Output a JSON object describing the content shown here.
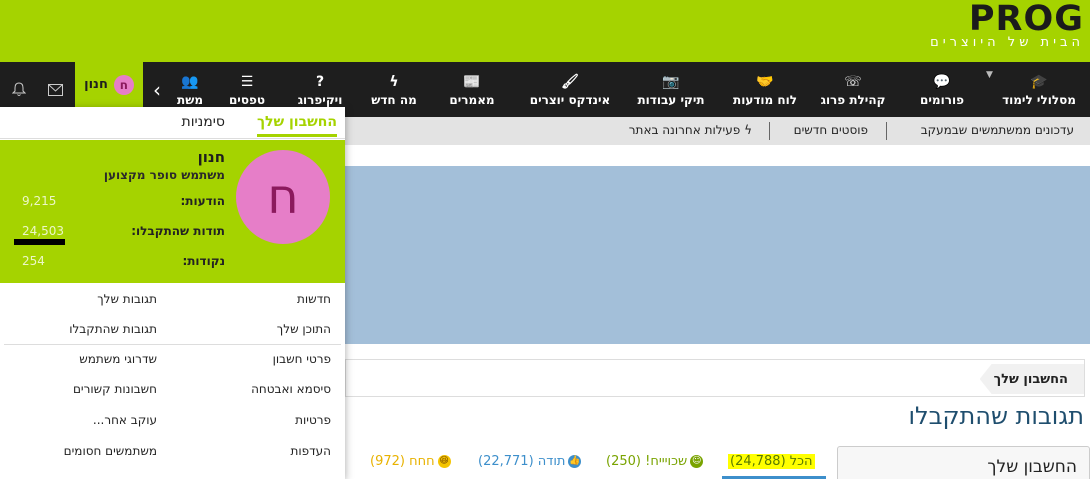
{
  "header": {
    "logo_word": "PROG",
    "logo_tagline": "הבית של היוצרים"
  },
  "nav": {
    "items": [
      {
        "label": "מסלולי לימוד",
        "icon": "graduation-cap-icon",
        "glyph": "🎓"
      },
      {
        "label": "פורומים",
        "icon": "speech-bubbles-icon",
        "glyph": "💬"
      },
      {
        "label": "קהילת פרוג",
        "icon": "whatsapp-icon",
        "glyph": "☏"
      },
      {
        "label": "לוח מודעות",
        "icon": "handshake-icon",
        "glyph": "🤝"
      },
      {
        "label": "תיקי עבודות",
        "icon": "camera-icon",
        "glyph": "📷"
      },
      {
        "label": "אינדקס יוצרים",
        "icon": "paintbrush-icon",
        "glyph": "🖌"
      },
      {
        "label": "מאמרים",
        "icon": "newspaper-icon",
        "glyph": "📰"
      },
      {
        "label": "מה חדש",
        "icon": "lightning-icon",
        "glyph": "ϟ"
      },
      {
        "label": "ויקיפרוג",
        "icon": "question-icon",
        "glyph": "?"
      },
      {
        "label": "טפסים",
        "icon": "list-icon",
        "glyph": "☰"
      },
      {
        "label": "משת",
        "icon": "users-icon",
        "glyph": "👥"
      }
    ],
    "user_name": "חנון",
    "user_initial": "ח"
  },
  "subnav": {
    "links": [
      "עדכונים ממשתמשים שבמעקב",
      "פוסטים חדשים",
      "פעילות אחרונה באתר"
    ]
  },
  "breadcrumb": "החשבון שלך",
  "page_title": "תגובות שהתקבלו",
  "sidebar_box_title": "החשבון שלך",
  "reactions": [
    {
      "label": "הכל (24,788)",
      "color": "#5a7a00"
    },
    {
      "label": "שכויייח! (250)",
      "color": "#79a300"
    },
    {
      "label": "תודה (22,771)",
      "color": "#3d8fcb"
    },
    {
      "label": "חחח (972)",
      "color": "#e8b200"
    }
  ],
  "dropdown": {
    "tab_account": "החשבון שלך",
    "tab_bookmarks": "סימניות",
    "profile": {
      "name": "חנון",
      "rank": "משתמש סופר מקצוען",
      "initial": "ח",
      "stats": [
        {
          "label": "הודעות:",
          "value": "9,215"
        },
        {
          "label": "תודות שהתקבלו:",
          "value": "24,503"
        },
        {
          "label": "נקודות:",
          "value": "254"
        }
      ]
    },
    "menu": {
      "news": "חדשות",
      "your_reactions": "תגובות שלך",
      "your_content": "התוכן שלך",
      "reactions_received": "תגובות שהתקבלו",
      "account_details": "פרטי חשבון",
      "user_upgrades": "שדרוגי משתמש",
      "password_security": "סיסמא ואבטחה",
      "linked_accounts": "חשבונות קשורים",
      "privacy": "פרטיות",
      "following": "עוקב אחר...",
      "preferences": "העדפות",
      "ignored_users": "משתמשים חסומים"
    }
  },
  "colors": {
    "brand_green": "#a5d300",
    "nav_dark": "#1e1e1e",
    "avatar_pink": "#e67ec8",
    "heading_blue": "#1f4e6e"
  }
}
